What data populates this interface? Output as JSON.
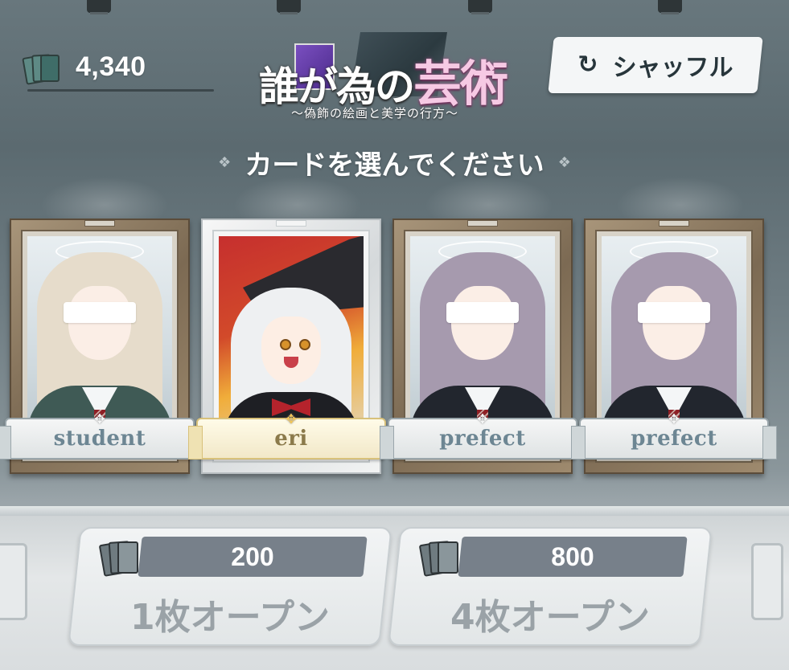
{
  "currency": {
    "icon": "card-deck-icon",
    "value": "4,340"
  },
  "logo": {
    "title_prefix": "誰が為の",
    "title_accent": "芸術",
    "subtitle": "〜偽飾の絵画と美学の行方〜"
  },
  "shuffle_button": {
    "icon": "refresh-icon",
    "label": "シャッフル"
  },
  "prompt": {
    "text": "カードを選んでください"
  },
  "cards": [
    {
      "label": "student",
      "style": "gold-frame",
      "hair_color": "#e6dccb",
      "uniform_color": "#3f5a55"
    },
    {
      "label": "eri",
      "style": "silver-frame",
      "hair_color": "#eef0f2",
      "uniform_color": "#1e1f24"
    },
    {
      "label": "prefect",
      "style": "gold-frame",
      "hair_color": "#a69aae",
      "uniform_color": "#22262e"
    },
    {
      "label": "prefect",
      "style": "gold-frame",
      "hair_color": "#a69aae",
      "uniform_color": "#22262e"
    }
  ],
  "open_buttons": [
    {
      "cost": "200",
      "label": "1枚オープン",
      "icon": "card-deck-icon"
    },
    {
      "cost": "800",
      "label": "4枚オープン",
      "icon": "card-deck-icon"
    }
  ]
}
